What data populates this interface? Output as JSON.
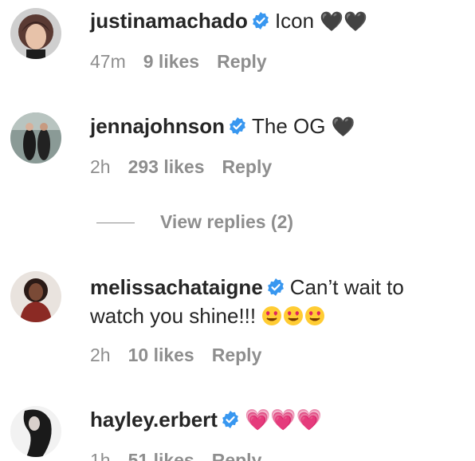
{
  "comments": [
    {
      "username": "justinamachado",
      "text": "Icon",
      "emoji": "🖤🖤",
      "time": "47m",
      "likes": "9 likes",
      "reply": "Reply"
    },
    {
      "username": "jennajohnson",
      "text": "The OG",
      "emoji": "🖤",
      "time": "2h",
      "likes": "293 likes",
      "reply": "Reply",
      "view_replies": "View replies (2)"
    },
    {
      "username": "melissachataigne",
      "text": "Can’t wait to",
      "text2": "watch you shine!!!",
      "emoji": "😍😍😍",
      "time": "2h",
      "likes": "10 likes",
      "reply": "Reply"
    },
    {
      "username": "hayley.erbert",
      "text": "",
      "emoji": "💗💗💗",
      "time": "1h",
      "likes": "51 likes",
      "reply": "Reply"
    }
  ],
  "colors": {
    "text": "#262626",
    "meta": "#8e8e8e",
    "verified": "#3897f0"
  },
  "icons": {
    "verified": "verified-badge-icon"
  }
}
